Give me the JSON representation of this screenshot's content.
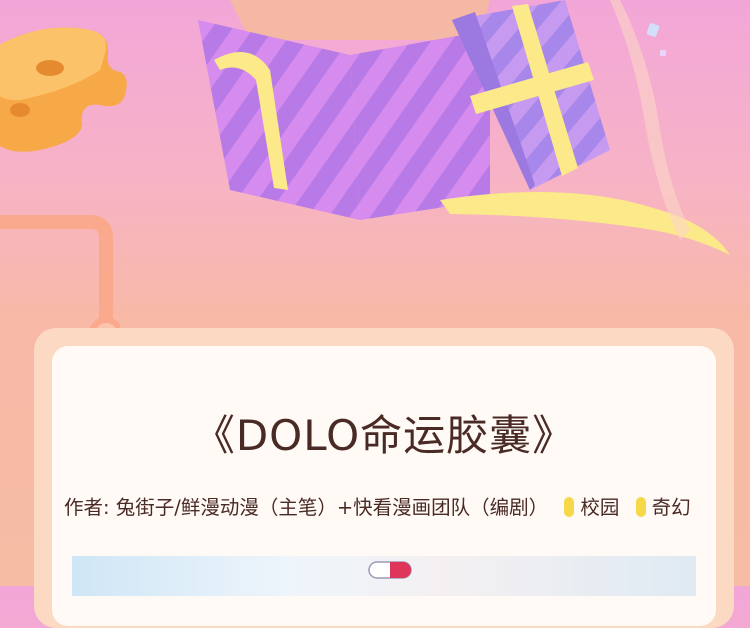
{
  "comic": {
    "title": "《DOLO命运胶囊》",
    "credits": "作者: 兔街子/鲜漫动漫（主笔）+快看漫画团队（编剧）",
    "tags": [
      "校园",
      "奇幻"
    ]
  },
  "colors": {
    "text": "#4a2a25",
    "tag_pill": "#f7d84a",
    "panel_border": "#fbd9c2",
    "gift_purple": "#c77de8",
    "ribbon": "#fbe98a"
  }
}
